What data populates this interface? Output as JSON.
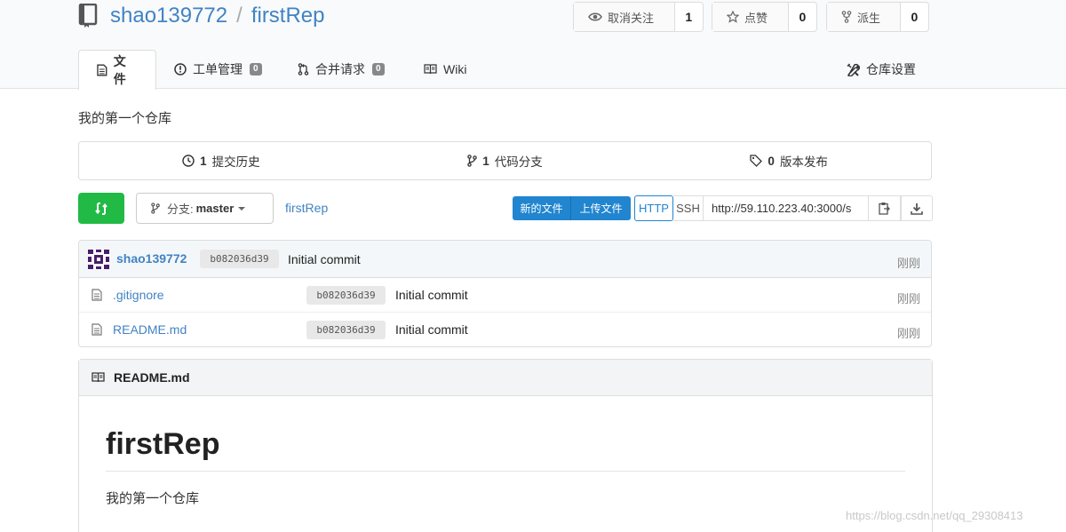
{
  "header": {
    "owner": "shao139772",
    "separator": "/",
    "repo": "firstRep",
    "unwatch": {
      "label": "取消关注",
      "count": "1"
    },
    "star": {
      "label": "点赞",
      "count": "0"
    },
    "fork": {
      "label": "派生",
      "count": "0"
    }
  },
  "tabs": {
    "files": "文件",
    "issues": {
      "label": "工单管理",
      "count": "0"
    },
    "pulls": {
      "label": "合并请求",
      "count": "0"
    },
    "wiki": "Wiki",
    "settings": "仓库设置"
  },
  "description": "我的第一个仓库",
  "stats": {
    "commits": {
      "count": "1",
      "label": "提交历史"
    },
    "branches": {
      "count": "1",
      "label": "代码分支"
    },
    "releases": {
      "count": "0",
      "label": "版本发布"
    }
  },
  "toolbar": {
    "branch_prefix": "分支:",
    "branch_name": "master",
    "path": "firstRep",
    "new_file": "新的文件",
    "upload_file": "上传文件",
    "http": "HTTP",
    "ssh": "SSH",
    "clone_url": "http://59.110.223.40:3000/s"
  },
  "latest_commit": {
    "author": "shao139772",
    "sha": "b082036d39",
    "message": "Initial commit",
    "time": "刚刚"
  },
  "files": [
    {
      "name": ".gitignore",
      "sha": "b082036d39",
      "message": "Initial commit",
      "time": "刚刚"
    },
    {
      "name": "README.md",
      "sha": "b082036d39",
      "message": "Initial commit",
      "time": "刚刚"
    }
  ],
  "readme": {
    "filename": "README.md",
    "heading": "firstRep",
    "text": "我的第一个仓库"
  },
  "watermark": "https://blog.csdn.net/qq_29308413",
  "colors": {
    "link": "#4183c4",
    "primary": "#2185d0",
    "success": "#21ba45"
  }
}
